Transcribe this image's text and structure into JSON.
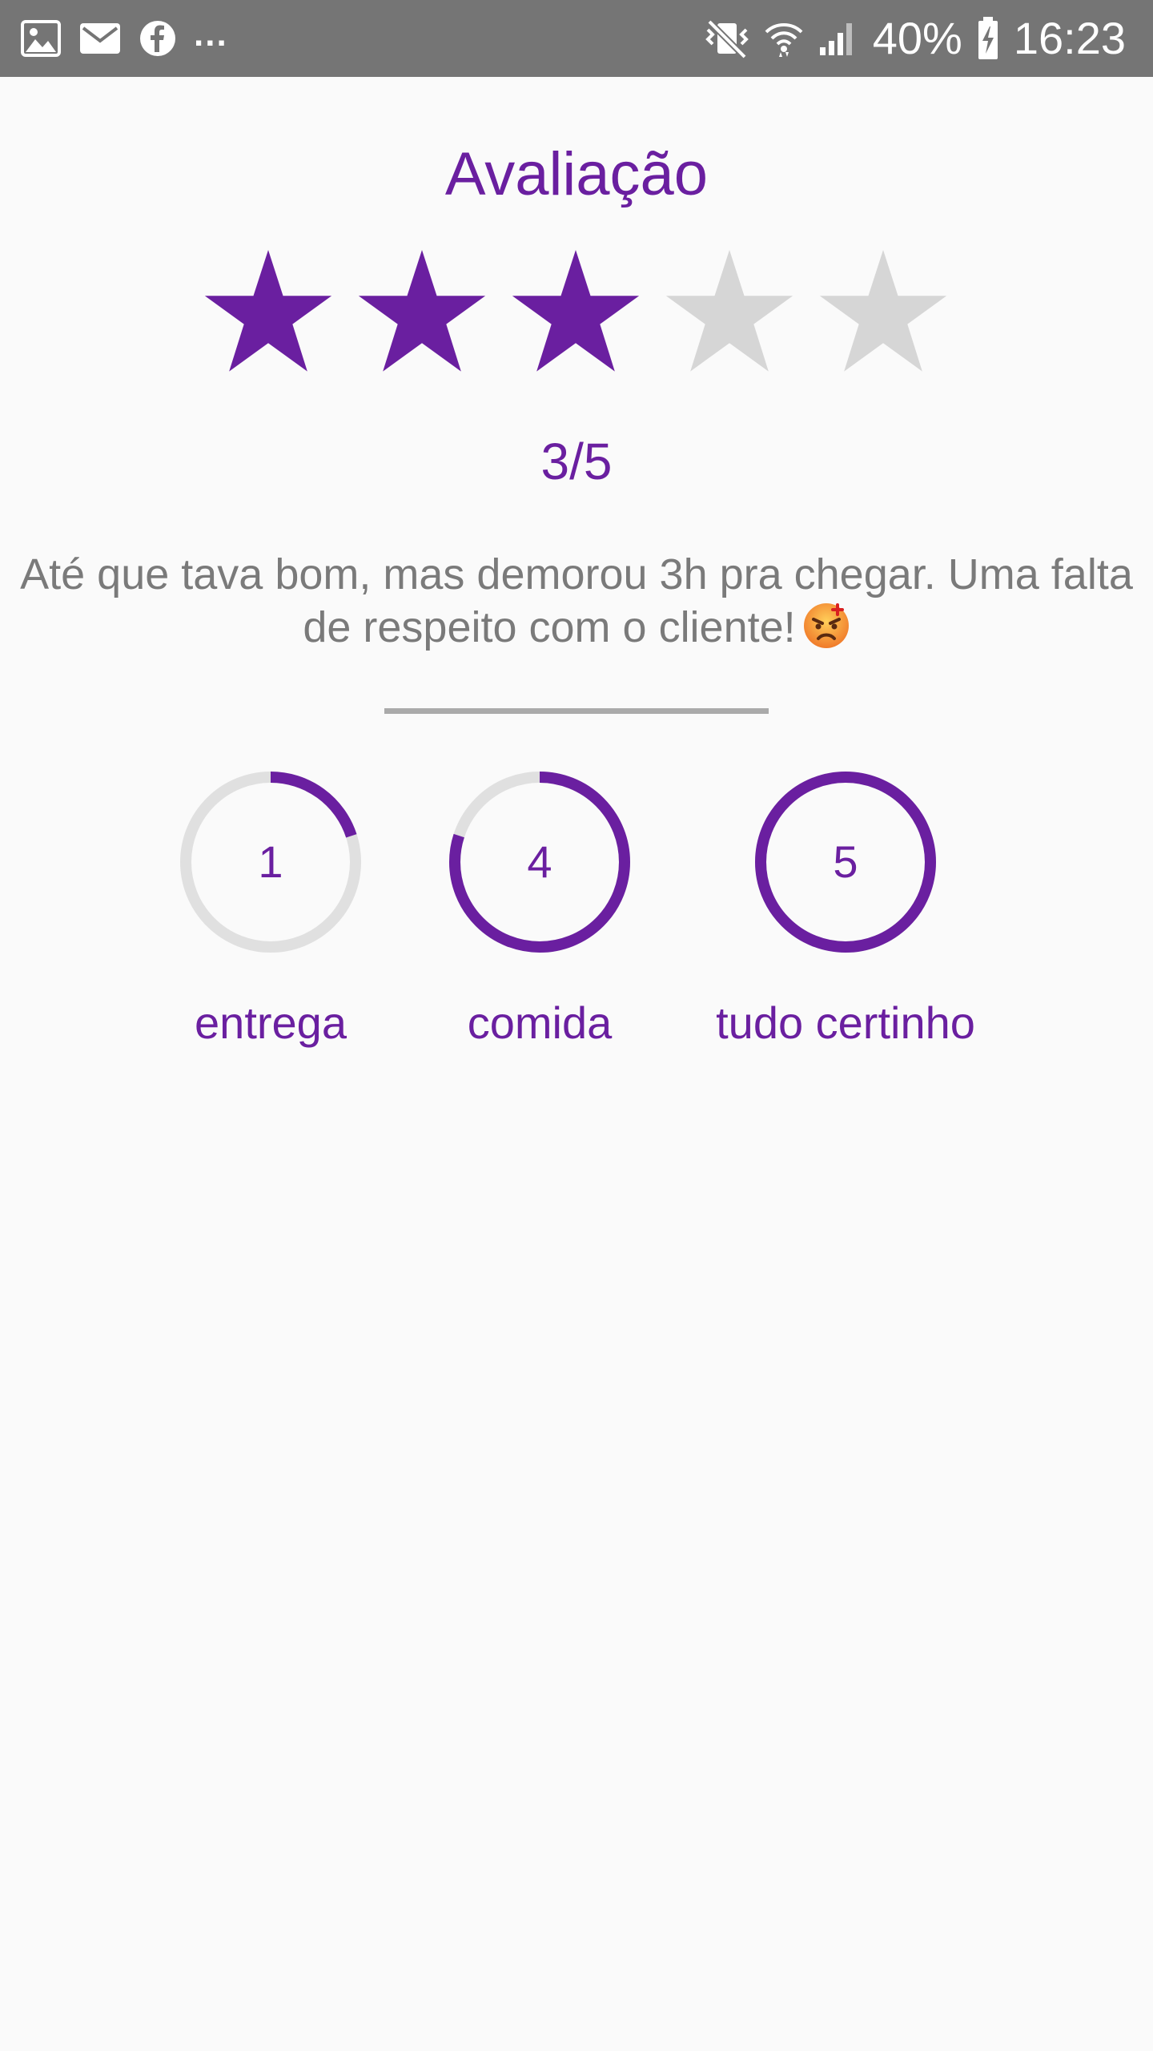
{
  "status_bar": {
    "battery": "40%",
    "time": "16:23",
    "overflow": "...",
    "left_icons": [
      "image-icon",
      "mail-icon",
      "facebook-icon"
    ],
    "right_icons": [
      "vibrate-icon",
      "wifi-icon",
      "signal-icon",
      "battery-icon"
    ]
  },
  "rating": {
    "title": "Avaliação",
    "score": "3/5",
    "stars_filled": 3,
    "stars_total": 5
  },
  "comment": {
    "text": "Até que tava bom, mas demorou 3h pra chegar. Uma falta de respeito com o cliente!",
    "emoji": "angry-face-icon"
  },
  "metrics": [
    {
      "label": "entrega",
      "value": "1",
      "progress": 0.2
    },
    {
      "label": "comida",
      "value": "4",
      "progress": 0.8
    },
    {
      "label": "tudo certinho",
      "value": "5",
      "progress": 1.0
    }
  ],
  "colors": {
    "accent": "#6a1fa0",
    "star_empty": "#d6d6d6",
    "ring_track": "#e0e0e0",
    "text_gray": "#7a7a7a",
    "status_bar": "#757575",
    "background": "#fafafa"
  }
}
